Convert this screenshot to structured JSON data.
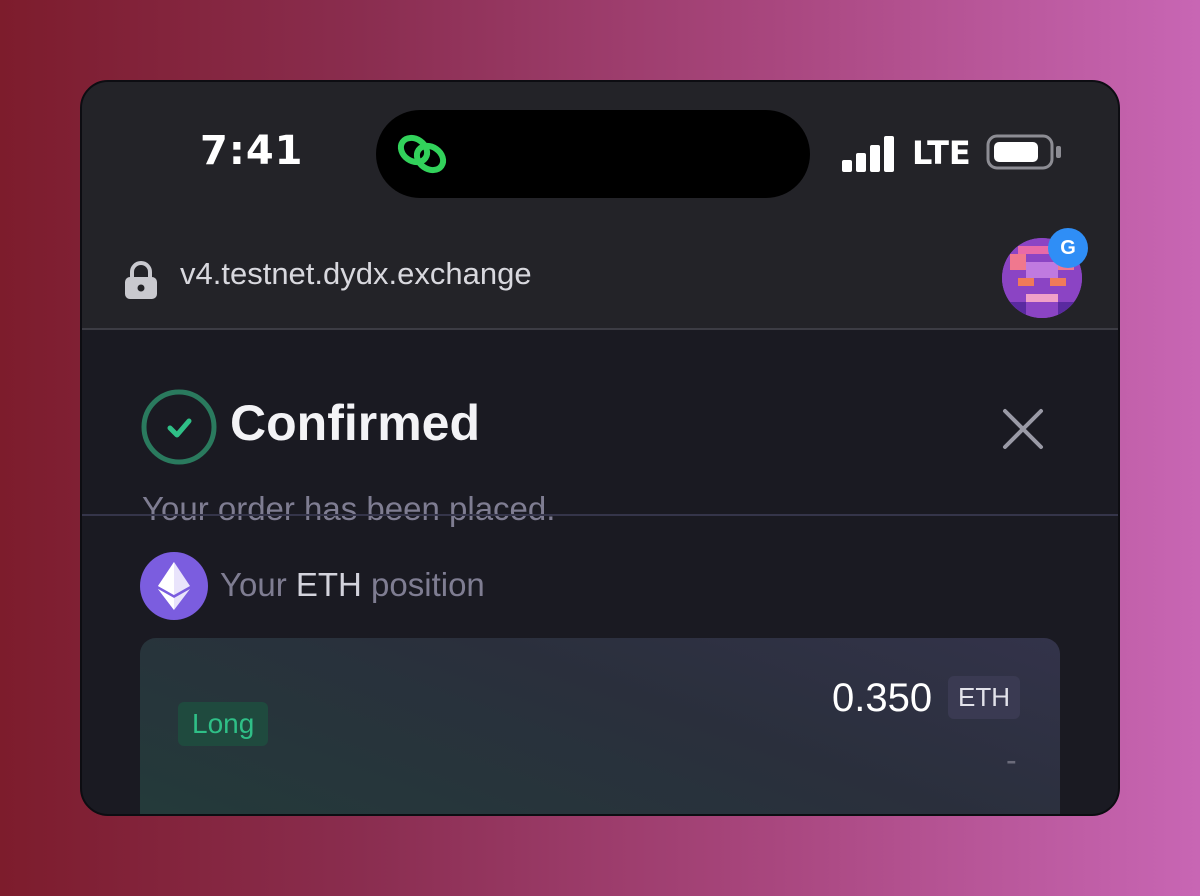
{
  "status_bar": {
    "time": "7:41",
    "network": "LTE",
    "icons": [
      "link-icon",
      "signal-bars-icon",
      "battery-icon"
    ]
  },
  "browser": {
    "url": "v4.testnet.dydx.exchange",
    "profile_badge": "G",
    "icons": [
      "lock-icon",
      "avatar"
    ]
  },
  "dialog": {
    "title": "Confirmed",
    "subtitle": "Your order has been placed.",
    "position_prefix": "Your",
    "position_asset": "ETH",
    "position_suffix": "position",
    "side": "Long",
    "size": "0.350",
    "size_unit": "ETH",
    "extra": "-",
    "icons": [
      "checkmark-circle-icon",
      "close-icon",
      "ethereum-icon"
    ]
  },
  "colors": {
    "accent_green": "#2fbf87",
    "background": "#1a1a22",
    "eth_purple": "#7b5ddf",
    "badge_blue": "#2f8ef6"
  }
}
